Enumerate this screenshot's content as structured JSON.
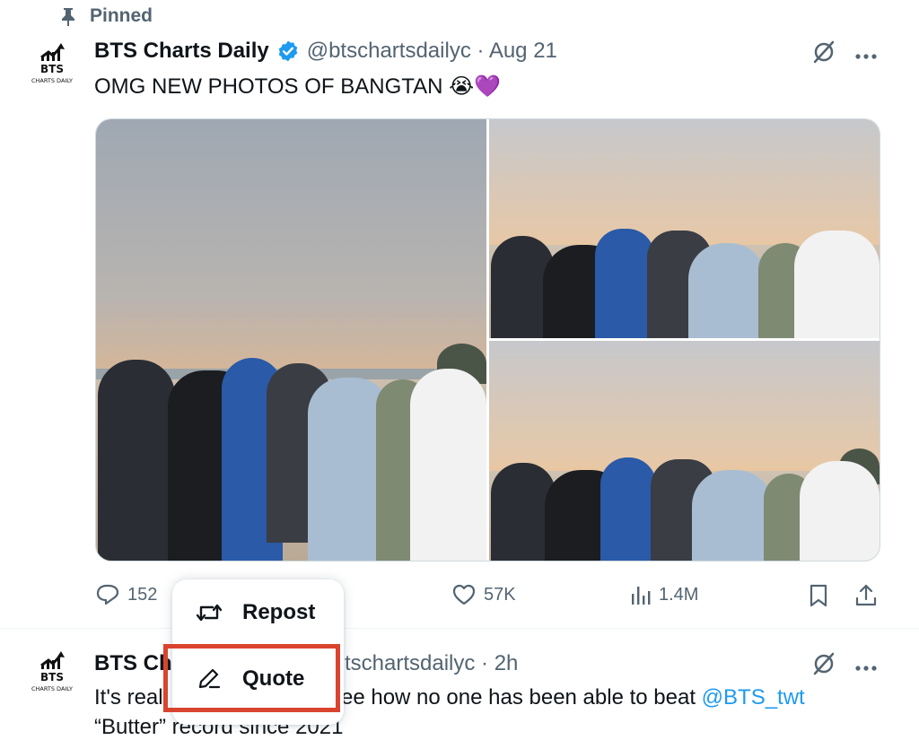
{
  "pinned_label": "Pinned",
  "tweet1": {
    "display_name": "BTS Charts Daily",
    "handle_date": "@btschartsdailyc · Aug 21",
    "text": "OMG NEW PHOTOS OF BANGTAN",
    "emojis": "😭💜",
    "avatar_text_1": "BTS",
    "avatar_text_2": "CHARTS DAILY",
    "actions": {
      "replies": "152",
      "likes": "57K",
      "views": "1.4M"
    }
  },
  "menu": {
    "repost_label": "Repost",
    "quote_label": "Quote"
  },
  "tweet2": {
    "display_name_visible": "BTS Ch",
    "handle_date_visible": "tschartsdailyc · 2h",
    "text_part1": "It's real",
    "text_part2": "ee how no one has been able to beat",
    "mention": "@BTS_twt",
    "text_line2": "“Butter” record since 2021",
    "avatar_text_1": "BTS",
    "avatar_text_2": "CHARTS DAILY"
  },
  "colors": {
    "accent": "#1d9bf0",
    "highlight": "#d9442f",
    "verified": "#1d9bf0"
  },
  "icons": {
    "pin": "pin-icon",
    "verified": "verified-badge-icon",
    "grok": "grok-icon",
    "more": "more-icon",
    "reply": "reply-icon",
    "like": "heart-icon",
    "views": "views-icon",
    "bookmark": "bookmark-icon",
    "share": "share-icon",
    "repost": "repost-icon",
    "quote": "pencil-icon"
  }
}
